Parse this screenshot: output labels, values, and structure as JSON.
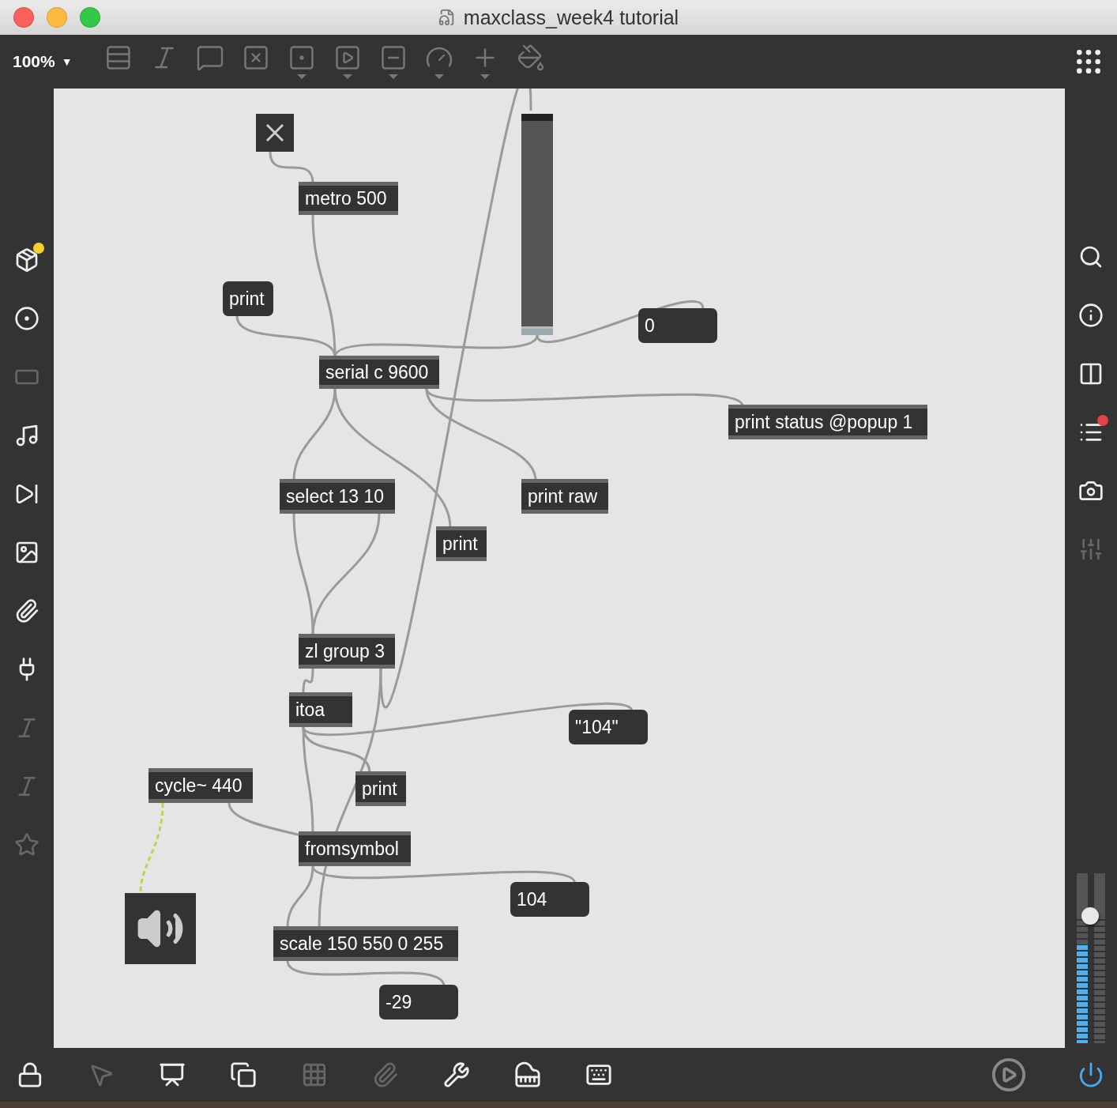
{
  "window": {
    "title": "maxclass_week4 tutorial"
  },
  "toolbar": {
    "zoom": "100%",
    "caret": "▼",
    "items": [
      {
        "kind": "object",
        "menu": false
      },
      {
        "kind": "message",
        "menu": false
      },
      {
        "kind": "comment",
        "menu": false
      },
      {
        "kind": "toggle",
        "menu": false
      },
      {
        "kind": "button",
        "menu": true
      },
      {
        "kind": "play",
        "menu": true
      },
      {
        "kind": "slider",
        "menu": true
      },
      {
        "kind": "dial",
        "menu": true
      },
      {
        "kind": "plus",
        "menu": true
      },
      {
        "kind": "paint",
        "menu": false
      }
    ]
  },
  "left_sidebar": [
    {
      "kind": "package",
      "disabled": false
    },
    {
      "kind": "target",
      "disabled": false
    },
    {
      "kind": "frame",
      "disabled": true
    },
    {
      "kind": "note",
      "disabled": false
    },
    {
      "kind": "step",
      "disabled": false
    },
    {
      "kind": "image",
      "disabled": false
    },
    {
      "kind": "clip",
      "disabled": false
    },
    {
      "kind": "plug",
      "disabled": false
    },
    {
      "kind": "v",
      "disabled": true
    },
    {
      "kind": "b",
      "disabled": true
    },
    {
      "kind": "star",
      "disabled": true
    }
  ],
  "right_sidebar": [
    {
      "kind": "search",
      "disabled": false
    },
    {
      "kind": "info",
      "disabled": false
    },
    {
      "kind": "columns",
      "disabled": false
    },
    {
      "kind": "list",
      "disabled": false
    },
    {
      "kind": "camera",
      "disabled": false
    },
    {
      "kind": "mixer",
      "disabled": true
    }
  ],
  "output": {
    "level": 0.76,
    "meters": [
      {
        "level": 0.76
      },
      {
        "level": 0
      }
    ]
  },
  "patch": [
    {
      "kind": "toggle",
      "checked": true
    },
    {
      "kind": "object",
      "text": "metro 500"
    },
    {
      "kind": "message",
      "text": "print"
    },
    {
      "kind": "slider",
      "level": 0.04
    },
    {
      "kind": "number",
      "text": "0"
    },
    {
      "kind": "object",
      "text": "serial c 9600"
    },
    {
      "kind": "object",
      "text": "print status @popup 1"
    },
    {
      "kind": "object",
      "text": "select 13 10"
    },
    {
      "kind": "object",
      "text": "print raw"
    },
    {
      "kind": "object",
      "text": "print"
    },
    {
      "kind": "object",
      "text": "zl group 3"
    },
    {
      "kind": "object",
      "text": "itoa"
    },
    {
      "kind": "message",
      "text": "\"104\""
    },
    {
      "kind": "object",
      "text": "cycle~ 440"
    },
    {
      "kind": "object",
      "text": "print"
    },
    {
      "kind": "object",
      "text": "fromsymbol"
    },
    {
      "kind": "number",
      "text": "104"
    },
    {
      "kind": "speaker"
    },
    {
      "kind": "object",
      "text": "scale 150 550 0 255"
    },
    {
      "kind": "number",
      "text": "-29"
    }
  ],
  "bottom_bar": [
    {
      "kind": "lock",
      "disabled": false
    },
    {
      "kind": "select",
      "disabled": true
    },
    {
      "kind": "presentation",
      "disabled": false
    },
    {
      "kind": "windows",
      "disabled": false
    },
    {
      "kind": "grid",
      "disabled": true
    },
    {
      "kind": "clipadd",
      "disabled": true
    },
    {
      "kind": "wrench",
      "disabled": false
    },
    {
      "kind": "piano",
      "disabled": false
    },
    {
      "kind": "keyboard",
      "disabled": false
    }
  ]
}
